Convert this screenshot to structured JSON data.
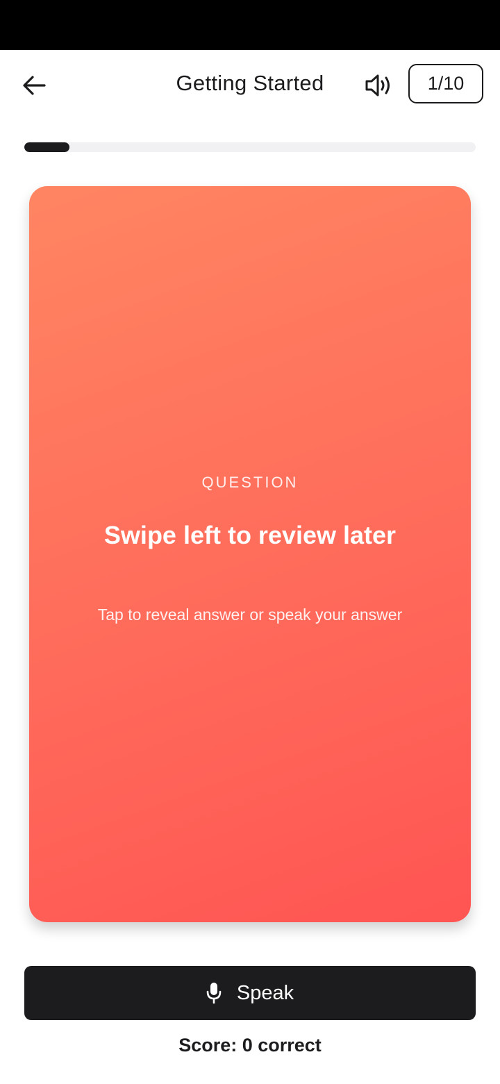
{
  "header": {
    "title": "Getting Started",
    "back_icon": "arrow-left-icon",
    "sound_icon": "speaker-icon",
    "counter": "1/10"
  },
  "progress": {
    "fraction": 0.1,
    "fill_color": "#1c1c1e",
    "track_color": "#f1f1f3"
  },
  "card": {
    "label": "QUESTION",
    "question": "Swipe left to review later",
    "hint": "Tap to reveal answer or speak your answer",
    "gradient_start": "#ff8562",
    "gradient_end": "#ff5553"
  },
  "actions": {
    "speak_label": "Speak",
    "speak_icon": "microphone-icon"
  },
  "score": {
    "text": "Score: 0 correct"
  }
}
